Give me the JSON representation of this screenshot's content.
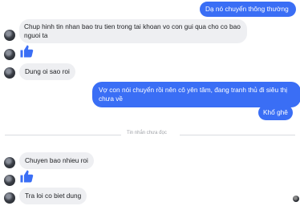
{
  "messages": {
    "out1": "Dạ nó chuyển thông thường",
    "in1": "Chup hinh tin nhan bao tru tien trong tai khoan vo con gui qua cho co bao nguoi ta",
    "in2": "Dung oi sao roi",
    "out2": "Vợ con nói chuyển rồi nên cô yên tâm, đang tranh thủ đi siêu thị chưa về",
    "out3": "Khổ ghê",
    "in3": "Chuyen bao nhieu roi",
    "in4": "Tra loi co biet dung"
  },
  "divider": {
    "label": "Tin nhắn chưa đọc"
  },
  "colors": {
    "outgoing": "#3a6ef5",
    "incoming": "#eeeff2",
    "like": "#3a6ef5"
  }
}
